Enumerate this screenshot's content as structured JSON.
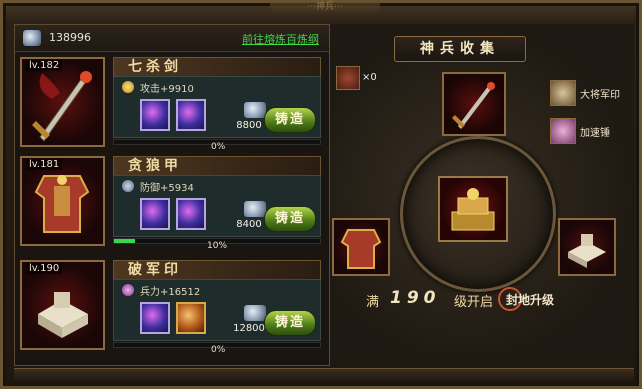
{
  "header": {
    "faded_title": "···神兵···"
  },
  "left": {
    "silver_icon": "silver-ingot-icon",
    "silver_amount": "138996",
    "link_text": "前往熔炼百炼纲",
    "items": [
      {
        "level": "lv.182",
        "name": "七杀剑",
        "stat_icon": "attack-coin-icon",
        "stat": "攻击+9910",
        "slots": [
          "purple-gem-icon",
          "purple-gem-icon"
        ],
        "cost": "8800",
        "forge_label": "铸造",
        "progress": 0,
        "progress_text": "0%"
      },
      {
        "level": "lv.181",
        "name": "贪狼甲",
        "stat_icon": "defense-shield-icon",
        "stat": "防御+5934",
        "slots": [
          "purple-gem-icon",
          "purple-gem-icon"
        ],
        "cost": "8400",
        "forge_label": "铸造",
        "progress": 10,
        "progress_text": "10%"
      },
      {
        "level": "lv.190",
        "name": "破军印",
        "stat_icon": "troop-icon",
        "stat": "兵力+16512",
        "slots": [
          "purple-gem-icon",
          "orange-scroll-icon"
        ],
        "cost": "12800",
        "forge_label": "铸造",
        "progress": 0,
        "progress_text": "0%"
      }
    ]
  },
  "right": {
    "title": "神兵收集",
    "hammer_icon": "hammer-icon",
    "hammer_count": "×0",
    "side_items": [
      {
        "icon": "general-seal-icon",
        "label": "大将军印"
      },
      {
        "icon": "speed-hammer-icon",
        "label": "加速锤"
      }
    ],
    "unlock_prefix": "满",
    "unlock_level": "190",
    "unlock_suffix": "级开启",
    "unlock_action": "封地升级"
  },
  "colors": {
    "forge_green": "#6c9a22",
    "progress_green": "#3cd64c",
    "gem_purple": "#8a5ad8"
  }
}
